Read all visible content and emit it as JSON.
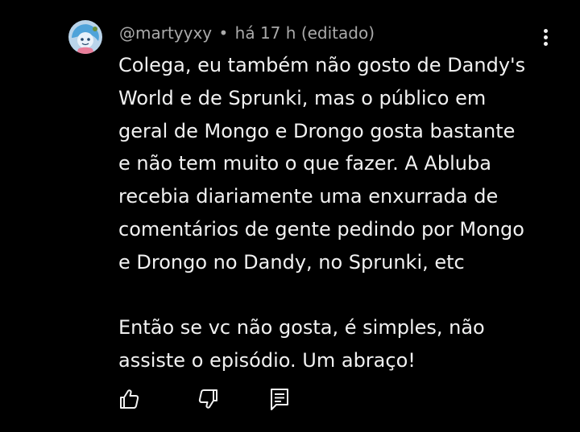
{
  "comment": {
    "author": "@martyyxy",
    "separator": "•",
    "time": "há 17 h",
    "edited": "(editado)",
    "text": "Colega, eu também não gosto de Dandy's\nWorld e de Sprunki, mas o público em\ngeral de Mongo e Drongo gosta bastante\ne não tem muito o que fazer. A Abluba\nrecebia diariamente uma enxurrada de\ncomentários de gente pedindo por Mongo\ne Drongo no Dandy, no Sprunki, etc\n\nEntão se vc não gosta, é simples, não\nassiste o episódio. Um abraço!"
  },
  "actions": {
    "like_icon": "thumbs-up-icon",
    "dislike_icon": "thumbs-down-icon",
    "reply_icon": "reply-comment-icon",
    "more_icon": "more-vertical-icon"
  },
  "colors": {
    "background": "#000000",
    "text_primary": "#f1f1f1",
    "text_secondary": "#aaaaaa",
    "avatar_background": "#b9d4ea",
    "avatar_character": "#4fa3d9"
  }
}
